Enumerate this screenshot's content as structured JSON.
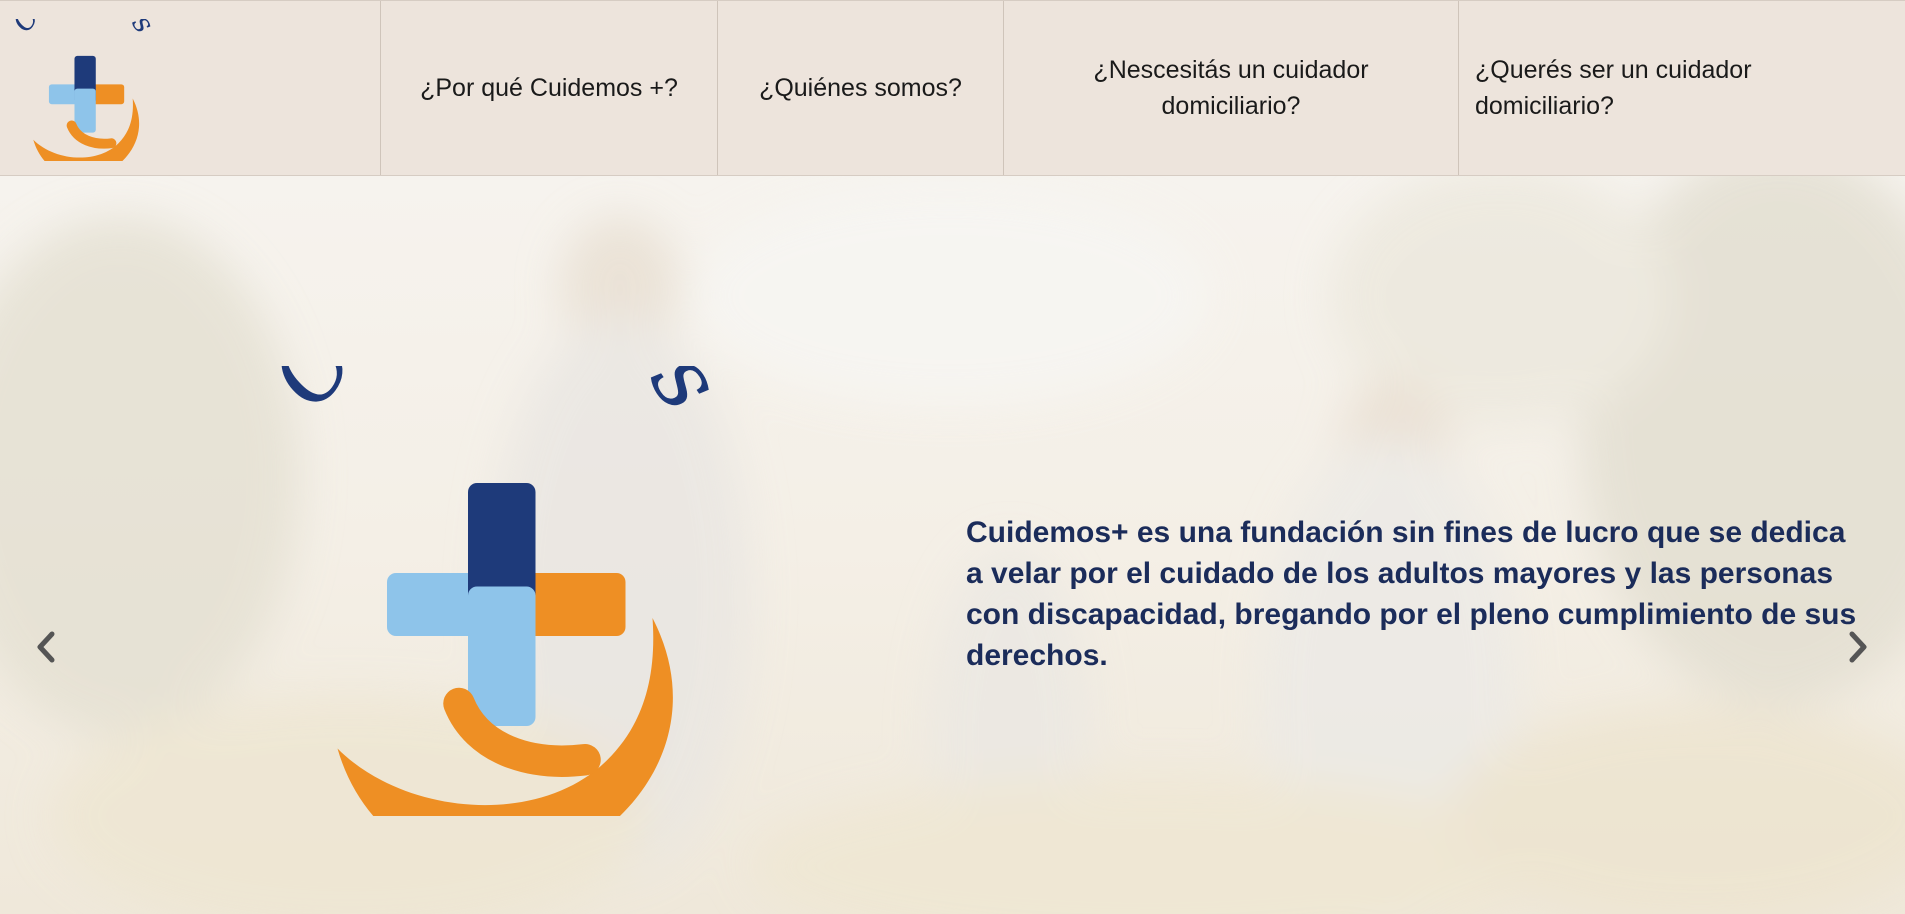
{
  "brand": {
    "logo_text": "Cuidemos",
    "icon": "cuidemos-logo"
  },
  "nav": {
    "items": [
      {
        "label": "¿Por qué Cuidemos +?"
      },
      {
        "label": "¿Quiénes somos?"
      },
      {
        "label": "¿Nescesitás un cuidador domiciliario?"
      },
      {
        "label": "¿Querés ser un cuidador domiciliario?"
      }
    ]
  },
  "hero": {
    "logo_text": "Cuidemos",
    "description": "Cuidemos+ es una fundación sin fines de lucro que se dedica a velar por el cuidado de los adultos mayores y las personas con discapacidad, bregando por el pleno cumplimiento de sus derechos.",
    "prev_icon": "chevron-left-icon",
    "next_icon": "chevron-right-icon"
  },
  "colors": {
    "nav_background": "#ede4dc",
    "hero_text": "#1b2c5a",
    "logo_navy": "#1e3a7a",
    "logo_light_blue": "#8ec4ea",
    "logo_orange": "#ee8f24"
  }
}
